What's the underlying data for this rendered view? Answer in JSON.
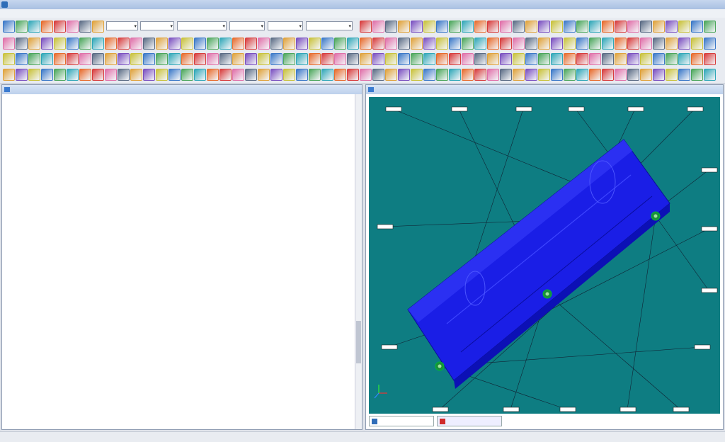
{
  "window": {
    "title": ""
  },
  "menubar": {
    "items": [
      "",
      "",
      "",
      "",
      "",
      "",
      ""
    ]
  },
  "toolbar": {
    "combos": [
      "",
      "",
      "",
      "",
      "",
      ""
    ]
  },
  "editor": {
    "title": "",
    "lines": [],
    "footer": []
  },
  "viewport": {
    "title": "",
    "background": "#0e7d82",
    "part_color": "#1a1ee6",
    "tab1": "",
    "tab2": ""
  },
  "statusbar": {
    "left": "",
    "coords": "",
    "right": ""
  },
  "colors": {
    "code": "#2d3f95",
    "accent": "#3b7bd0"
  }
}
